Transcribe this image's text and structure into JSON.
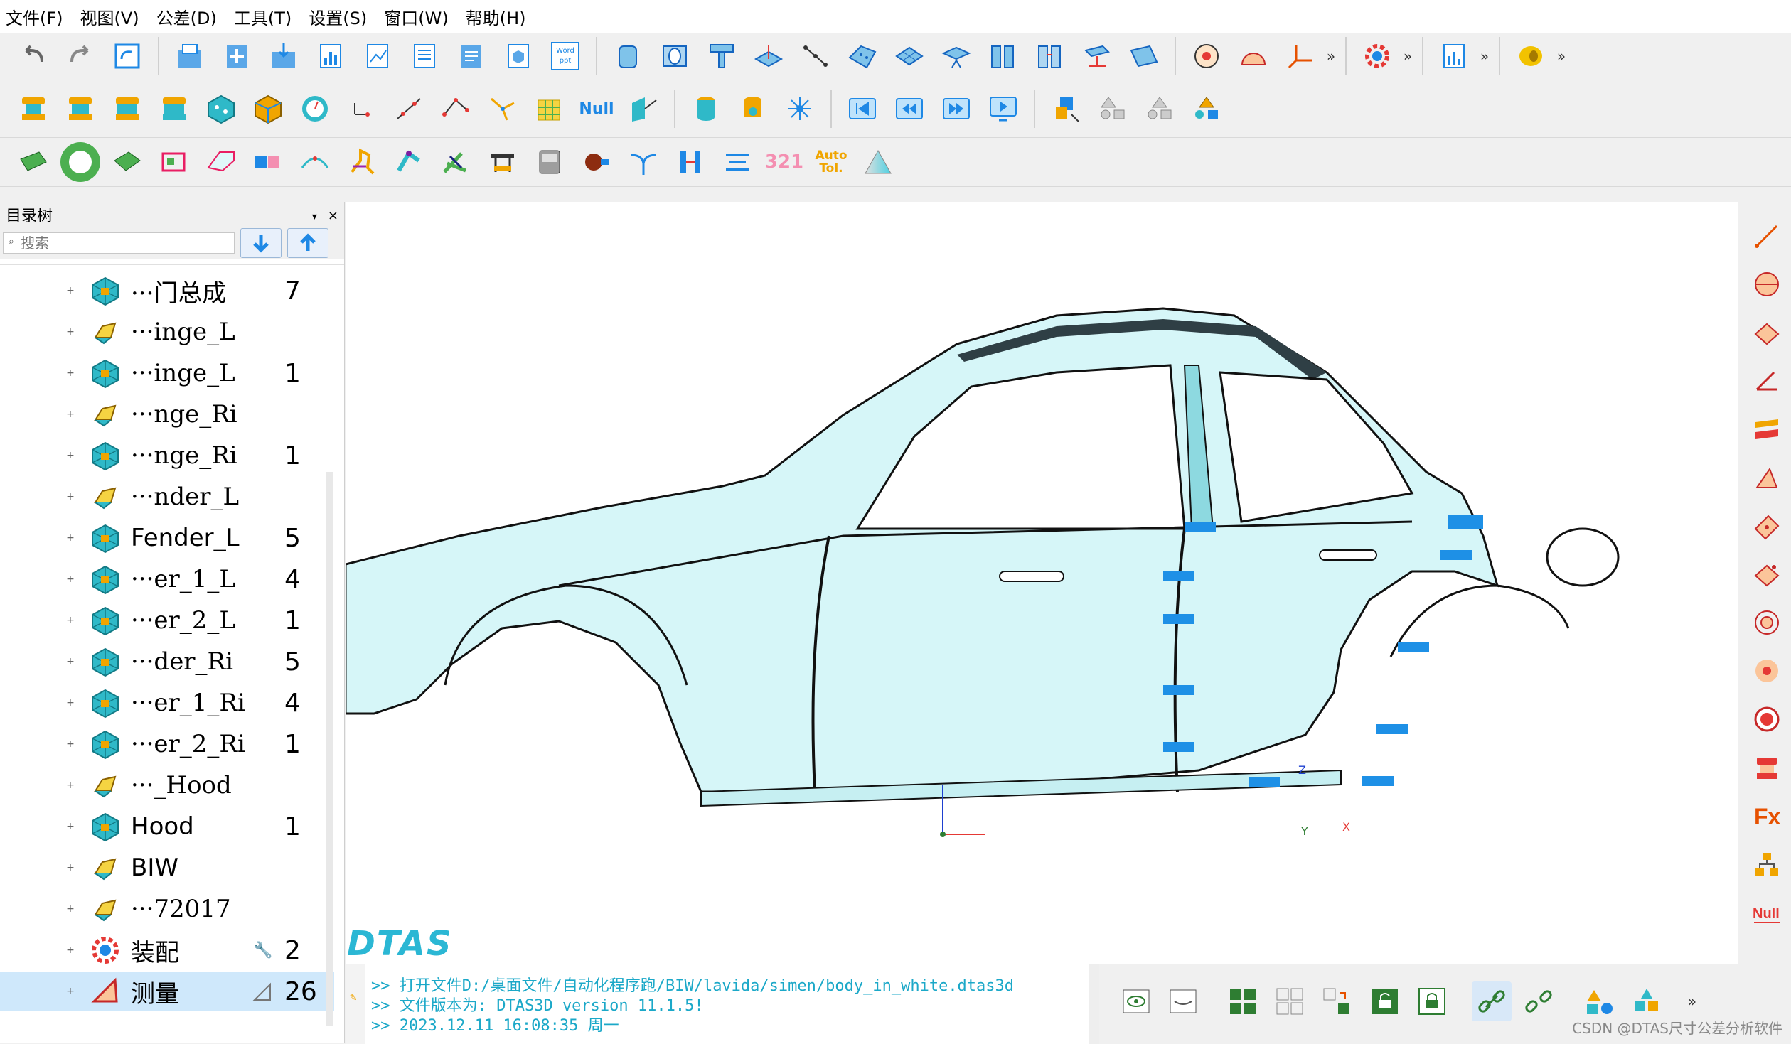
{
  "menu": [
    "文件(F)",
    "视图(V)",
    "公差(D)",
    "工具(T)",
    "设置(S)",
    "窗口(W)",
    "帮助(H)"
  ],
  "toolbar": {
    "word_ppt_label_1": "Word",
    "word_ppt_label_2": "ppt",
    "null_label": "Null",
    "num_321": "321",
    "auto_tol_1": "Auto",
    "auto_tol_2": "Tol."
  },
  "tree": {
    "title": "目录树",
    "pin": "▾",
    "close": "×",
    "search_placeholder": "搜索",
    "items": [
      {
        "label": "···门总成",
        "count": "7",
        "icon": "assembly-icon"
      },
      {
        "label": "···inge_L",
        "count": "",
        "icon": "part-icon"
      },
      {
        "label": "···inge_L",
        "count": "1",
        "icon": "assembly-icon"
      },
      {
        "label": "···nge_Ri",
        "count": "",
        "icon": "part-icon"
      },
      {
        "label": "···nge_Ri",
        "count": "1",
        "icon": "assembly-icon"
      },
      {
        "label": "···nder_L",
        "count": "",
        "icon": "part-icon"
      },
      {
        "label": "Fender_L",
        "count": "5",
        "icon": "assembly-icon"
      },
      {
        "label": "···er_1_L",
        "count": "4",
        "icon": "assembly-icon"
      },
      {
        "label": "···er_2_L",
        "count": "1",
        "icon": "assembly-icon"
      },
      {
        "label": "···der_Ri",
        "count": "5",
        "icon": "assembly-icon"
      },
      {
        "label": "···er_1_Ri",
        "count": "4",
        "icon": "assembly-icon"
      },
      {
        "label": "···er_2_Ri",
        "count": "1",
        "icon": "assembly-icon"
      },
      {
        "label": "···_Hood",
        "count": "",
        "icon": "part-icon"
      },
      {
        "label": "Hood",
        "count": "1",
        "icon": "assembly-icon"
      },
      {
        "label": "BIW",
        "count": "",
        "icon": "part-icon"
      },
      {
        "label": "···72017",
        "count": "",
        "icon": "part-icon"
      },
      {
        "label": "装配",
        "count": "2",
        "icon": "assembly-gear-icon"
      },
      {
        "label": "测量",
        "count": "26",
        "icon": "measure-icon"
      }
    ]
  },
  "viewport": {
    "logo": "DTAS",
    "axis_z": "Z",
    "axis_y": "Y",
    "axis_x": "X"
  },
  "console": {
    "lines": [
      ">>   打开文件D:/桌面文件/自动化程序跑/BIW/lavida/simen/body_in_white.dtas3d",
      ">>   文件版本为: DTAS3D  version  11.1.5!",
      ">>   2023.12.11  16:08:35  周一"
    ]
  },
  "watermark": "CSDN @DTAS尺寸公差分析软件",
  "colors": {
    "accent": "#1e88e5",
    "teal": "#2fb9c8",
    "car_fill": "#d6f6f8",
    "console_text": "#1ba8c8"
  }
}
